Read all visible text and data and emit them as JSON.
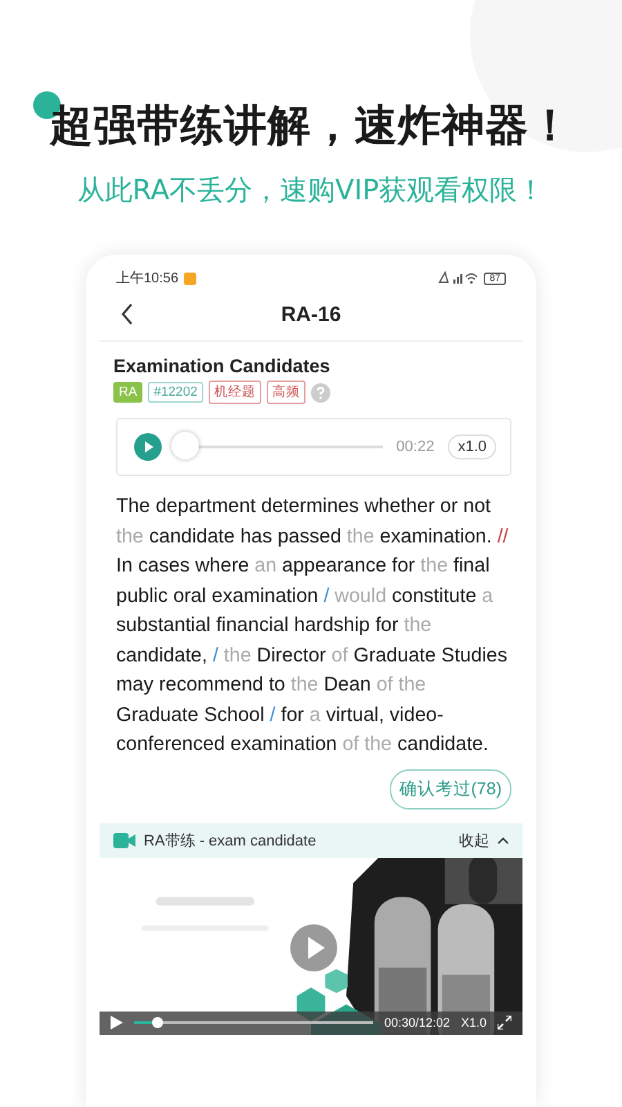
{
  "headline": "超强带练讲解，速炸神器！",
  "subheadline": "从此RA不丢分，速购VIP获观看权限！",
  "status_bar": {
    "time": "上午10:56",
    "battery": "87"
  },
  "header": {
    "title": "RA-16"
  },
  "question": {
    "title": "Examination Candidates",
    "tags": [
      {
        "label": "RA",
        "kind": "type"
      },
      {
        "label": "#12202",
        "kind": "id"
      },
      {
        "label": "机经题",
        "kind": "flag"
      },
      {
        "label": "高频",
        "kind": "flag"
      }
    ]
  },
  "audio": {
    "level": 0.05,
    "time": "00:22",
    "speed": "x1.0"
  },
  "passage": [
    {
      "text": "The department determines whether or not ",
      "kind": "normal"
    },
    {
      "text": "the",
      "kind": "weak"
    },
    {
      "text": " candidate has passed ",
      "kind": "normal"
    },
    {
      "text": "the",
      "kind": "weak"
    },
    {
      "text": " examination. ",
      "kind": "normal"
    },
    {
      "text": "//",
      "kind": "long-pause"
    },
    {
      "text": " In cases where ",
      "kind": "normal"
    },
    {
      "text": "an",
      "kind": "weak"
    },
    {
      "text": " appearance for ",
      "kind": "normal"
    },
    {
      "text": "the",
      "kind": "weak"
    },
    {
      "text": " final public oral examination ",
      "kind": "normal"
    },
    {
      "text": "/",
      "kind": "short-pause"
    },
    {
      "text": " would",
      "kind": "weak"
    },
    {
      "text": " constitute ",
      "kind": "normal"
    },
    {
      "text": "a",
      "kind": "weak"
    },
    {
      "text": " substantial financial hardship for ",
      "kind": "normal"
    },
    {
      "text": "the",
      "kind": "weak"
    },
    {
      "text": " candidate, ",
      "kind": "normal"
    },
    {
      "text": "/",
      "kind": "short-pause"
    },
    {
      "text": " the",
      "kind": "weak"
    },
    {
      "text": " Director ",
      "kind": "normal"
    },
    {
      "text": "of",
      "kind": "weak"
    },
    {
      "text": " Graduate Studies may recommend to ",
      "kind": "normal"
    },
    {
      "text": "the",
      "kind": "weak"
    },
    {
      "text": " Dean ",
      "kind": "normal"
    },
    {
      "text": "of the",
      "kind": "weak"
    },
    {
      "text": " Graduate School ",
      "kind": "normal"
    },
    {
      "text": "/",
      "kind": "short-pause"
    },
    {
      "text": " for ",
      "kind": "normal"
    },
    {
      "text": "a",
      "kind": "weak"
    },
    {
      "text": " virtual, video-conferenced examination ",
      "kind": "normal"
    },
    {
      "text": "of the",
      "kind": "weak"
    },
    {
      "text": " candidate.",
      "kind": "normal"
    }
  ],
  "confirm_button": "确认考过(78)",
  "video": {
    "title": "RA带练 - exam candidate",
    "collapse": "收起",
    "level": 0.1,
    "time": "00:30/12:02",
    "speed": "X1.0"
  }
}
